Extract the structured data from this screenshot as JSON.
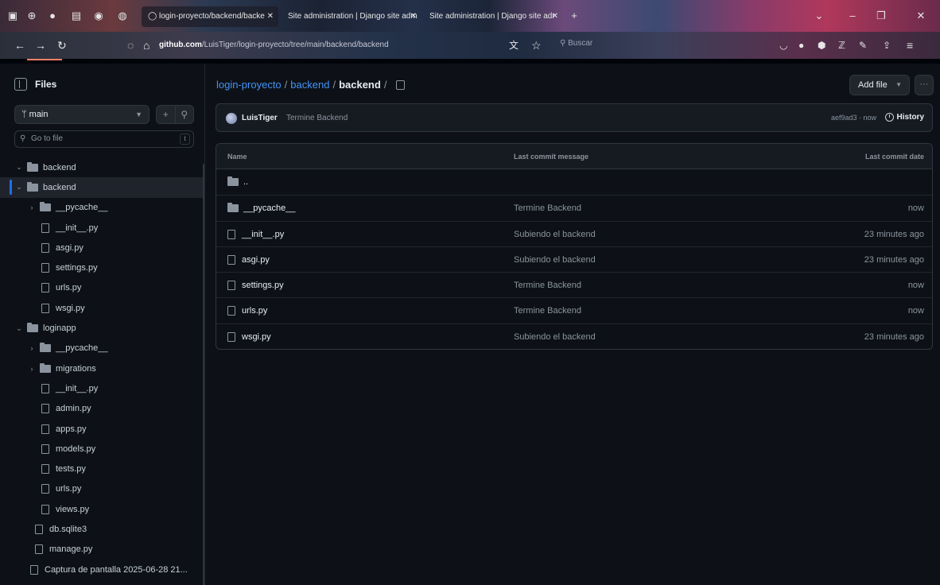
{
  "browser": {
    "tabs": [
      {
        "title": "login-proyecto/backend/backe",
        "active": true
      },
      {
        "title": "Site administration | Django site adm",
        "active": false
      },
      {
        "title": "Site administration | Django site adr",
        "active": false
      }
    ],
    "new_tab": "+",
    "url_domain": "github.com",
    "url_path": "/LuisTiger/login-proyecto/tree/main/backend/backend",
    "search_placeholder": "Buscar"
  },
  "sidebar": {
    "title": "Files",
    "branch": "main",
    "goto_placeholder": "Go to file",
    "goto_shortcut": "t",
    "tree": [
      {
        "label": "backend",
        "type": "folder",
        "depth": 0,
        "expanded": true,
        "selected": false
      },
      {
        "label": "backend",
        "type": "folder",
        "depth": 0,
        "expanded": true,
        "selected": true
      },
      {
        "label": "__pycache__",
        "type": "folder",
        "depth": 1,
        "expanded": false,
        "selected": false
      },
      {
        "label": "__init__.py",
        "type": "file",
        "depth": 2,
        "selected": false
      },
      {
        "label": "asgi.py",
        "type": "file",
        "depth": 2,
        "selected": false
      },
      {
        "label": "settings.py",
        "type": "file",
        "depth": 2,
        "selected": false
      },
      {
        "label": "urls.py",
        "type": "file",
        "depth": 2,
        "selected": false
      },
      {
        "label": "wsgi.py",
        "type": "file",
        "depth": 2,
        "selected": false
      },
      {
        "label": "loginapp",
        "type": "folder",
        "depth": 0,
        "expanded": true,
        "selected": false
      },
      {
        "label": "__pycache__",
        "type": "folder",
        "depth": 1,
        "expanded": false,
        "selected": false
      },
      {
        "label": "migrations",
        "type": "folder",
        "depth": 1,
        "expanded": false,
        "selected": false
      },
      {
        "label": "__init__.py",
        "type": "file",
        "depth": 2,
        "selected": false
      },
      {
        "label": "admin.py",
        "type": "file",
        "depth": 2,
        "selected": false
      },
      {
        "label": "apps.py",
        "type": "file",
        "depth": 2,
        "selected": false
      },
      {
        "label": "models.py",
        "type": "file",
        "depth": 2,
        "selected": false
      },
      {
        "label": "tests.py",
        "type": "file",
        "depth": 2,
        "selected": false
      },
      {
        "label": "urls.py",
        "type": "file",
        "depth": 2,
        "selected": false
      },
      {
        "label": "views.py",
        "type": "file",
        "depth": 2,
        "selected": false
      },
      {
        "label": "db.sqlite3",
        "type": "file",
        "depth": 1,
        "selected": false
      },
      {
        "label": "manage.py",
        "type": "file",
        "depth": 1,
        "selected": false
      },
      {
        "label": "Captura de pantalla 2025-06-28 21...",
        "type": "file",
        "depth": 0,
        "selected": false
      }
    ]
  },
  "main": {
    "breadcrumb": {
      "repo": "login-proyecto",
      "folder": "backend",
      "current": "backend",
      "sep": "/"
    },
    "add_file": "Add file",
    "more": "···",
    "commit": {
      "author": "LuisTiger",
      "message": "Termine Backend",
      "meta": "aef9ad3 · now",
      "history": "History"
    },
    "table": {
      "headers": {
        "name": "Name",
        "message": "Last commit message",
        "date": "Last commit date"
      },
      "rows": [
        {
          "name": "..",
          "type": "folder",
          "message": "",
          "date": ""
        },
        {
          "name": "__pycache__",
          "type": "folder",
          "message": "Termine Backend",
          "date": "now"
        },
        {
          "name": "__init__.py",
          "type": "file",
          "message": "Subiendo el backend",
          "date": "23 minutes ago"
        },
        {
          "name": "asgi.py",
          "type": "file",
          "message": "Subiendo el backend",
          "date": "23 minutes ago"
        },
        {
          "name": "settings.py",
          "type": "file",
          "message": "Termine Backend",
          "date": "now"
        },
        {
          "name": "urls.py",
          "type": "file",
          "message": "Termine Backend",
          "date": "now"
        },
        {
          "name": "wsgi.py",
          "type": "file",
          "message": "Subiendo el backend",
          "date": "23 minutes ago"
        }
      ]
    }
  },
  "colors": {
    "background": "#0d1117",
    "link": "#4493f8",
    "border": "#30363d",
    "accent": "#1f6feb"
  }
}
